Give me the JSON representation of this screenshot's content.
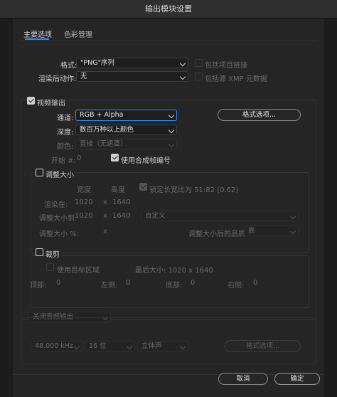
{
  "window": {
    "title": "输出模块设置"
  },
  "tabs": [
    {
      "label": "主要选项"
    },
    {
      "label": "色彩管理"
    }
  ],
  "main": {
    "format_label": "格式:",
    "format_value": "\"PNG\"序列",
    "include_project_link": "包括项目链接",
    "post_render_label": "渲染后动作:",
    "post_render_value": "无",
    "include_xmp": "包括源 XMP 元数据"
  },
  "video": {
    "title": "视频输出",
    "channels_label": "通道:",
    "channels_value": "RGB + Alpha",
    "format_options_button": "格式选项...",
    "depth_label": "深度:",
    "depth_value": "数百万种以上颜色",
    "color_label": "颜色:",
    "color_value": "直接（无遮罩）",
    "start_label": "开始 #:",
    "start_value": "0",
    "use_comp_frame": "使用合成帧编号"
  },
  "resize": {
    "title": "调整大小",
    "width_header": "宽度",
    "height_header": "高度",
    "lock_aspect": "锁定长宽比为 51:82 (0.62)",
    "render_at_label": "渲染在:",
    "render_at_w": "1020",
    "x1": "x",
    "render_at_h": "1640",
    "resize_to_label": "调整大小到:",
    "resize_to_w": "1020",
    "x2": "x",
    "resize_to_h": "1640",
    "preset_value": "自定义",
    "percent_label": "调整大小 %:",
    "x3": "x",
    "quality_label": "调整大小后的品质:",
    "quality_value": "高"
  },
  "crop": {
    "title": "裁剪",
    "use_roi": "使用目标区域",
    "final_size": "最后大小: 1020 x 1640",
    "top_label": "顶部:",
    "top_value": "0",
    "left_label": "左侧:",
    "left_value": "0",
    "bottom_label": "底部:",
    "bottom_value": "0",
    "right_label": "右侧:",
    "right_value": "0"
  },
  "audio": {
    "mode_value": "关闭音频输出",
    "rate_value": "48.000 kHz",
    "bits_value": "16 位",
    "channels_value": "立体声",
    "format_options_button": "格式选项..."
  },
  "footer": {
    "cancel": "取消",
    "ok": "确定"
  },
  "colors": {
    "accent": "#2a8cff",
    "background": "#252525"
  }
}
